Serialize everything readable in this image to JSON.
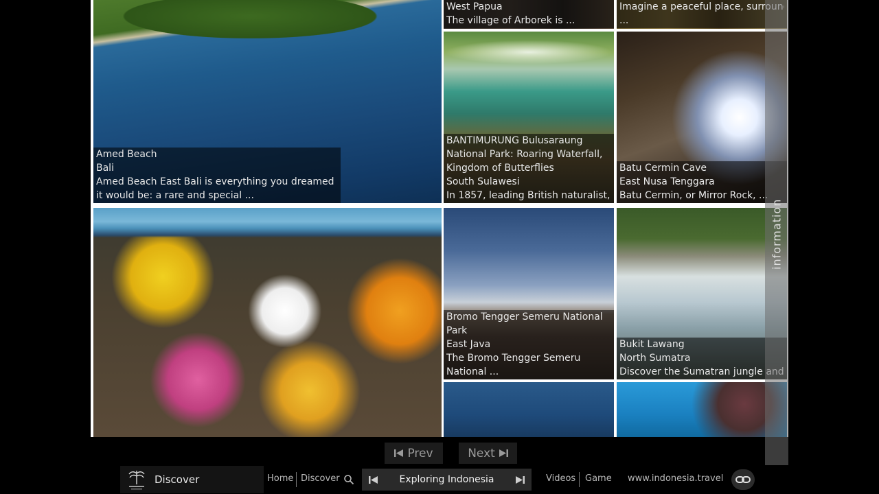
{
  "tiles": {
    "west_papua": {
      "region": "West Papua",
      "desc": "The village of Arborek is ..."
    },
    "imagine": {
      "desc1": "Imagine a peaceful place, surrounded",
      "desc2": "..."
    },
    "amed": {
      "title": "Amed Beach",
      "region": "Bali",
      "desc": "Amed Beach East Bali is everything you dreamed it would be: a rare and special ..."
    },
    "bantimurung": {
      "title": "BANTIMURUNG Bulusaraung National Park: Roaring Waterfall, Kingdom of Butterflies",
      "region": "South Sulawesi",
      "desc": "In 1857, leading British naturalist, ..."
    },
    "batu": {
      "title": "Batu Cermin Cave",
      "region": "East Nusa Tenggara",
      "desc": "Batu Cermin, or Mirror Rock, ..."
    },
    "bromo": {
      "title": "Bromo Tengger Semeru National Park",
      "region": "East Java",
      "desc": "The Bromo Tengger Semeru National ..."
    },
    "bukit": {
      "title": "Bukit Lawang",
      "region": "North Sumatra",
      "desc": "Discover the Sumatran jungle and ..."
    }
  },
  "info_tab": {
    "label": "information"
  },
  "pager": {
    "prev_label": "Prev",
    "next_label": "Next"
  },
  "bottom_bar": {
    "section_label": "Discover",
    "nav": {
      "home": "Home",
      "discover": "Discover",
      "videos": "Videos",
      "game": "Game",
      "site": "www.indonesia.travel"
    },
    "player_title": "Exploring Indonesia"
  }
}
